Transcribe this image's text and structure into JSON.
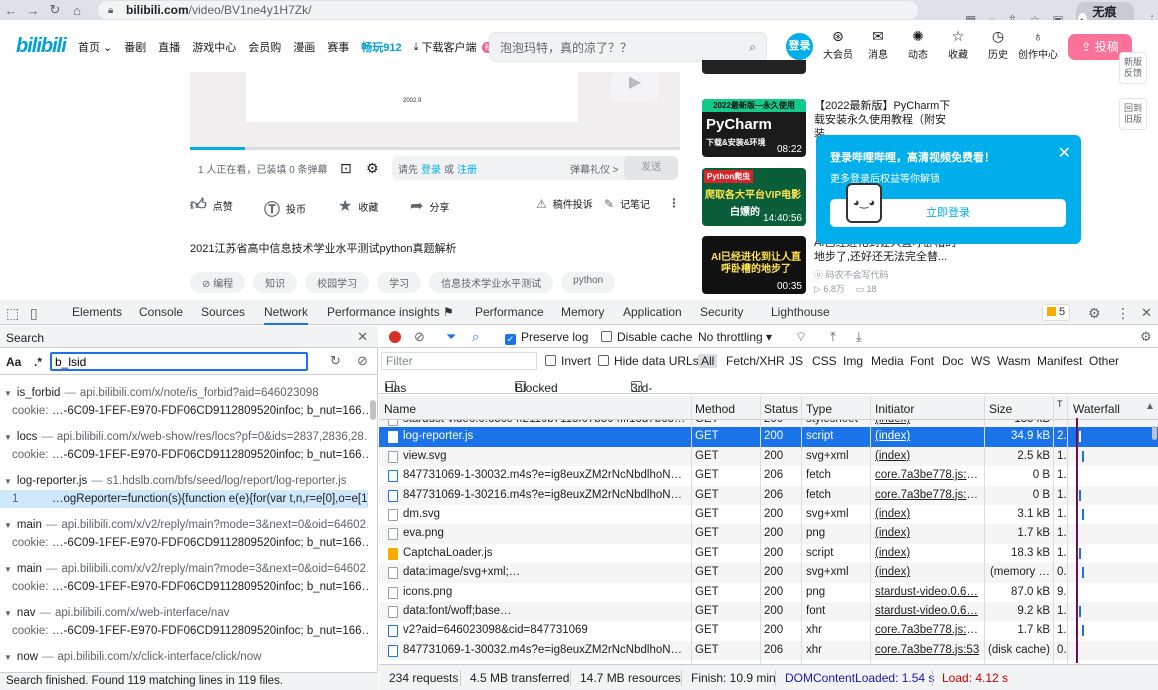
{
  "browser": {
    "url_domain": "bilibili.com",
    "url_path": "/video/BV1ne4y1H7Zk/",
    "profile": "无痕模式"
  },
  "bili": {
    "logo": "bilibili",
    "nav": [
      "首页",
      "番剧",
      "直播",
      "游戏中心",
      "会员购",
      "漫画",
      "赛事",
      "畅玩912",
      "下载客户端"
    ],
    "download_badge": "新",
    "search_placeholder": "泡泡玛特，真的凉了？？",
    "login": "登录",
    "header_icons": [
      "大会员",
      "消息",
      "动态",
      "收藏",
      "历史",
      "创作中心"
    ],
    "upload": "投稿",
    "side_buttons": [
      "新版反馈",
      "回到旧版"
    ]
  },
  "player": {
    "slide_label": "2002.9",
    "viewers": "1 人正在看，已装填 0 条弹幕",
    "danmu_prefix": "请先",
    "danmu_login": "登录",
    "danmu_or": "或",
    "danmu_register": "注册",
    "danmu_etiquette": "弹幕礼仪 >",
    "send": "发送"
  },
  "actions": {
    "like": "点赞",
    "coin": "投币",
    "favorite": "收藏",
    "share": "分享",
    "report": "稿件投诉",
    "notes": "记笔记"
  },
  "video_title": "2021江苏省高中信息技术学业水平测试python真题解析",
  "tags": [
    "编程",
    "知识",
    "校园学习",
    "学习",
    "信息技术学业水平测试",
    "python"
  ],
  "recommendations": [
    {
      "thumb": "PyCharm",
      "thumb_banner": "2022最新版—永久使用",
      "thumb_sub": "下载&安装&环境",
      "duration": "08:22",
      "title": "【2022最新版】PyCharm下载安装永久使用教程（附安装...",
      "uploader": "",
      "stats": ""
    },
    {
      "thumb": "爬取各大平台VIP电影",
      "thumb_banner": "Python爬虫",
      "thumb_sub": "白嫖的",
      "duration": "14:40:56",
      "title": "",
      "uploader": "",
      "stats": ""
    },
    {
      "thumb": "AI已经进化到让人直呼卧槽的地步了",
      "thumb_banner": "",
      "thumb_sub": "",
      "duration": "00:35",
      "title": "AI已经进化到让人直呼卧槽的地步了,还好还无法完全替...",
      "uploader": "码农不会写代码",
      "stats_views": "6.8万",
      "stats_danmu": "18"
    }
  ],
  "login_popup": {
    "title": "登录哔哩哔哩，高清视频免费看！",
    "subtitle": "更多登录后权益等你解锁",
    "button": "立即登录"
  },
  "devtools": {
    "tabs": [
      "Elements",
      "Console",
      "Sources",
      "Network",
      "Performance insights ⚑",
      "Performance",
      "Memory",
      "Application",
      "Security",
      "Lighthouse"
    ],
    "active_tab": "Network",
    "issues_count": "5",
    "search_panel": {
      "title": "Search",
      "case_label": "Aa",
      "regex_label": ".*",
      "query": "b_lsid",
      "results": [
        {
          "file": "is_forbid",
          "url": "api.bilibili.com/x/note/is_forbid?aid=646023098",
          "match_key": "cookie:",
          "match": "…-6C09-1FEF-E970-FDF06CD9112809520infoc; b_nut=166…"
        },
        {
          "file": "locs",
          "url": "api.bilibili.com/x/web-show/res/locs?pf=0&ids=2837,2836,28…",
          "match_key": "cookie:",
          "match": "…-6C09-1FEF-E970-FDF06CD9112809520infoc; b_nut=166…"
        },
        {
          "file": "log-reporter.js",
          "url": "s1.hdslb.com/bfs/seed/log/report/log-reporter.js",
          "match_key": "1",
          "match": "…ogReporter=function(s){function e(e){for(var t,n,r=e[0],o=e[1],i=0,…"
        },
        {
          "file": "main",
          "url": "api.bilibili.com/x/v2/reply/main?mode=3&next=0&oid=64602…",
          "match_key": "cookie:",
          "match": "…-6C09-1FEF-E970-FDF06CD9112809520infoc; b_nut=166…"
        },
        {
          "file": "main",
          "url": "api.bilibili.com/x/v2/reply/main?mode=3&next=0&oid=64602…",
          "match_key": "cookie:",
          "match": "…-6C09-1FEF-E970-FDF06CD9112809520infoc; b_nut=166…"
        },
        {
          "file": "nav",
          "url": "api.bilibili.com/x/web-interface/nav",
          "match_key": "cookie:",
          "match": "…-6C09-1FEF-E970-FDF06CD9112809520infoc; b_nut=166…"
        },
        {
          "file": "now",
          "url": "api.bilibili.com/x/click-interface/click/now",
          "match_key": "",
          "match": ""
        }
      ],
      "status": "Search finished.  Found 119 matching lines in 119 files."
    },
    "network": {
      "preserve_log": "Preserve log",
      "disable_cache": "Disable cache",
      "throttle": "No throttling",
      "filter_placeholder": "Filter",
      "invert": "Invert",
      "hide_data_urls": "Hide data URLs",
      "types": [
        "All",
        "Fetch/XHR",
        "JS",
        "CSS",
        "Img",
        "Media",
        "Font",
        "Doc",
        "WS",
        "Wasm",
        "Manifest",
        "Other"
      ],
      "blocked_cookies": "Has blocked cookies",
      "blocked_requests": "Blocked Requests",
      "third_party": "3rd-party requests",
      "columns": [
        "Name",
        "Method",
        "Status",
        "Type",
        "Initiator",
        "Size",
        "T",
        "Waterfall"
      ],
      "rows": [
        {
          "name": "stardust-video.0.65ce4f2110b7118f07b504fff13d7b63d…",
          "method": "GET",
          "status": "200",
          "type": "stylesheet",
          "initiator": "(index)",
          "size": "135 kB",
          "time": "",
          "icon": "css"
        },
        {
          "name": "log-reporter.js",
          "method": "GET",
          "status": "200",
          "type": "script",
          "initiator": "(index)",
          "size": "34.9 kB",
          "time": "2.",
          "icon": "js"
        },
        {
          "name": "view.svg",
          "method": "GET",
          "status": "200",
          "type": "svg+xml",
          "initiator": "(index)",
          "size": "2.5 kB",
          "time": "1.",
          "icon": "img"
        },
        {
          "name": "847731069-1-30032.m4s?e=ig8euxZM2rNcNbdlhoNv…",
          "method": "GET",
          "status": "206",
          "type": "fetch",
          "initiator": "core.7a3be778.js:3…",
          "size": "0 B",
          "time": "1.",
          "icon": "doc"
        },
        {
          "name": "847731069-1-30216.m4s?e=ig8euxZM2rNcNbdlhoNv…",
          "method": "GET",
          "status": "206",
          "type": "fetch",
          "initiator": "core.7a3be778.js:3…",
          "size": "0 B",
          "time": "1.",
          "icon": "doc"
        },
        {
          "name": "dm.svg",
          "method": "GET",
          "status": "200",
          "type": "svg+xml",
          "initiator": "(index)",
          "size": "3.1 kB",
          "time": "1.",
          "icon": "img"
        },
        {
          "name": "eva.png",
          "method": "GET",
          "status": "200",
          "type": "png",
          "initiator": "(index)",
          "size": "1.7 kB",
          "time": "1.",
          "icon": "img"
        },
        {
          "name": "CaptchaLoader.js",
          "method": "GET",
          "status": "200",
          "type": "script",
          "initiator": "(index)",
          "size": "18.3 kB",
          "time": "1.",
          "icon": "js"
        },
        {
          "name": "data:image/svg+xml;…",
          "method": "GET",
          "status": "200",
          "type": "svg+xml",
          "initiator": "(index)",
          "size": "(memory …",
          "time": "0.",
          "icon": "img"
        },
        {
          "name": "icons.png",
          "method": "GET",
          "status": "200",
          "type": "png",
          "initiator": "stardust-video.0.6…",
          "size": "87.0 kB",
          "time": "9.",
          "icon": "img"
        },
        {
          "name": "data:font/woff;base…",
          "method": "GET",
          "status": "200",
          "type": "font",
          "initiator": "stardust-video.0.6…",
          "size": "9.2 kB",
          "time": "1.",
          "icon": "font"
        },
        {
          "name": "v2?aid=646023098&cid=847731069",
          "method": "GET",
          "status": "200",
          "type": "xhr",
          "initiator": "core.7a3be778.js:2…",
          "size": "1.7 kB",
          "time": "1.",
          "icon": "doc"
        },
        {
          "name": "847731069-1-30032.m4s?e=ig8euxZM2rNcNbdlhoNv…",
          "method": "GET",
          "status": "206",
          "type": "xhr",
          "initiator": "core.7a3be778.js:53",
          "size": "(disk cache)",
          "time": "0.",
          "icon": "doc"
        }
      ],
      "selected_row": 1,
      "footer": [
        "234 requests",
        "4.5 MB transferred",
        "14.7 MB resources",
        "Finish: 10.9 min",
        "DOMContentLoaded: 1.54 s",
        "Load: 4.12 s"
      ],
      "dcl_color": "#1a1aa6",
      "load_color": "#c80000"
    }
  }
}
